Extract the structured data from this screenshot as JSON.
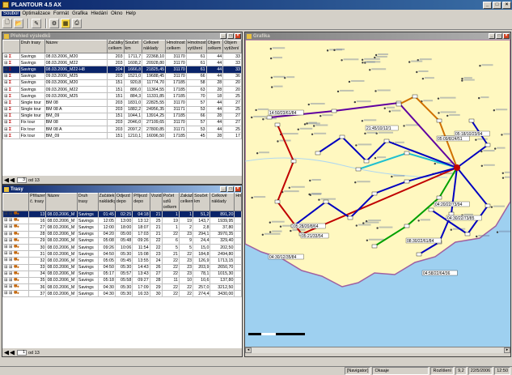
{
  "app": {
    "title": "PLANTOUR 4.5   AX"
  },
  "menu": [
    "Soubor",
    "Optimalizace",
    "Formát",
    "Grafika",
    "Hledání",
    "Okno",
    "Help"
  ],
  "prehled": {
    "title": "Přehled výsledků",
    "headers": [
      "",
      "Druh trasy",
      "Název",
      "Začátky celkem",
      "Součet km",
      "Celkové náklady",
      "Hmotnost celkem",
      "Hmotnost vytížení",
      "Objem celkem",
      "Objem vytížení"
    ],
    "rows": [
      [
        "Savings",
        "08.03.2006_M20",
        "203",
        "1711,7",
        "22368,10",
        "31170",
        "61",
        "44",
        "33"
      ],
      [
        "Savings",
        "08.03.2006_M22",
        "203",
        "1608,2",
        "20928,80",
        "31170",
        "61",
        "44",
        "33"
      ],
      [
        "Savings",
        "08.03.2006_M22-H8",
        "204",
        "1666,8",
        "21825,45",
        "31170",
        "61",
        "44",
        "33"
      ],
      [
        "Savings",
        "09.03.2006_M25",
        "203",
        "1521,0",
        "19688,45",
        "31170",
        "66",
        "44",
        "36"
      ],
      [
        "Savings",
        "09.03.2006_M20",
        "151",
        "920,8",
        "11774,70",
        "17185",
        "58",
        "28",
        "20"
      ],
      [
        "Savings",
        "09.03.2006_M22",
        "151",
        "886,0",
        "11364,55",
        "17185",
        "63",
        "28",
        "20"
      ],
      [
        "Savings",
        "09.03.2006_M25",
        "151",
        "884,3",
        "11331,85",
        "17185",
        "70",
        "18",
        "25"
      ],
      [
        "Single tour",
        "BM 08",
        "203",
        "1831,0",
        "22825,55",
        "31170",
        "57",
        "44",
        "27"
      ],
      [
        "Single tour",
        "BM 08 A",
        "203",
        "1882,2",
        "24956,35",
        "31171",
        "53",
        "44",
        "25"
      ],
      [
        "Single tour",
        "BM_09",
        "151",
        "1044,1",
        "13914,25",
        "17185",
        "66",
        "28",
        "27"
      ],
      [
        "Fix tour",
        "BM 08",
        "203",
        "2046,0",
        "27109,65",
        "31170",
        "57",
        "44",
        "27"
      ],
      [
        "Fix tour",
        "BM 08 A",
        "203",
        "2097,2",
        "27800,85",
        "31171",
        "53",
        "44",
        "25"
      ],
      [
        "Fix tour",
        "BM_09",
        "151",
        "1210,1",
        "16096,50",
        "17185",
        "45",
        "28",
        "17"
      ]
    ],
    "selected_row": 2,
    "page": "3",
    "page_of": "od 13"
  },
  "trasy": {
    "title": "Trasy",
    "headers": [
      "",
      "Přiřazeno č. trasy",
      "Název",
      "Druh trasy",
      "Začátek nakládky",
      "Odjezd depo",
      "Příjezd depo",
      "Vozidlo",
      "Počet uzlů celkem",
      "Zakázky celkem",
      "Součet km",
      "Celkové náklady",
      "Hm"
    ],
    "rows": [
      [
        "13",
        "08.03.2006_M",
        "Savings",
        "01:45",
        "02:25",
        "04:18",
        "21",
        "1",
        "1",
        "51,2",
        "891,20"
      ],
      [
        "16",
        "08.03.2006_M",
        "Savings",
        "12:05",
        "13:00",
        "13:12",
        "25",
        "19",
        "19",
        "143,7",
        "1939,95"
      ],
      [
        "27",
        "08.03.2006_M",
        "Savings",
        "12:00",
        "18:00",
        "18:07",
        "21",
        "1",
        "2",
        "2,8",
        "37,80"
      ],
      [
        "28",
        "08.03.2006_M",
        "Savings",
        "04:20",
        "05:00",
        "17:03",
        "21",
        "22",
        "23",
        "294,1",
        "3970,35"
      ],
      [
        "29",
        "08.03.2006_M",
        "Savings",
        "05:08",
        "05:48",
        "09:26",
        "22",
        "6",
        "9",
        "24,4",
        "329,40"
      ],
      [
        "30",
        "08.03.2006_M",
        "Savings",
        "09:26",
        "10:06",
        "11:54",
        "22",
        "5",
        "5",
        "15,0",
        "202,50"
      ],
      [
        "31",
        "08.03.2006_M",
        "Savings",
        "04:50",
        "05:30",
        "15:08",
        "23",
        "21",
        "22",
        "184,8",
        "2494,80"
      ],
      [
        "32",
        "08.03.2006_M",
        "Savings",
        "05:05",
        "05:45",
        "13:55",
        "24",
        "22",
        "23",
        "126,9",
        "1713,15"
      ],
      [
        "33",
        "08.03.2006_M",
        "Savings",
        "04:50",
        "05:30",
        "14:43",
        "26",
        "22",
        "23",
        "203,9",
        "2650,70"
      ],
      [
        "34",
        "08.03.2006_M",
        "Savings",
        "05:17",
        "05:57",
        "13:43",
        "27",
        "22",
        "23",
        "78,1",
        "1015,30"
      ],
      [
        "35",
        "08.03.2006_M",
        "Savings",
        "05:18",
        "05:58",
        "09:27",
        "28",
        "11",
        "10",
        "10,6",
        "137,80"
      ],
      [
        "36",
        "08.03.2006_M",
        "Savings",
        "04:30",
        "05:30",
        "17:09",
        "29",
        "22",
        "22",
        "257,0",
        "3212,50"
      ],
      [
        "37",
        "08.03.2006_M",
        "Savings",
        "04:30",
        "05:30",
        "16:33",
        "30",
        "22",
        "22",
        "274,4",
        "3430,00"
      ]
    ],
    "selected_row": 0,
    "page": "1",
    "page_of": "od 13"
  },
  "grafika": {
    "title": "Grafika",
    "route_labels": [
      "14:50/23/61/84",
      "21:45/10/12/1",
      "05:09/8/24/51",
      "05:18/10/23/94",
      "05:28/20/8/64",
      "05:21/33/54",
      "04:30/12/35/84",
      "08:30/22/61/84",
      "04:20/22/73/94",
      "04:30/22/73/85",
      "04:58/22/64/36"
    ],
    "colors": {
      "land": "#fff8c0",
      "sea": "#9ed0f0",
      "border": "#a060a0"
    }
  },
  "status": {
    "navigator": "[Navigator]",
    "ok": "Okaaje",
    "rozliseni_label": "Rozlišení",
    "rozliseni": "9,2",
    "date": "22/5/2006",
    "time": "12:50"
  }
}
